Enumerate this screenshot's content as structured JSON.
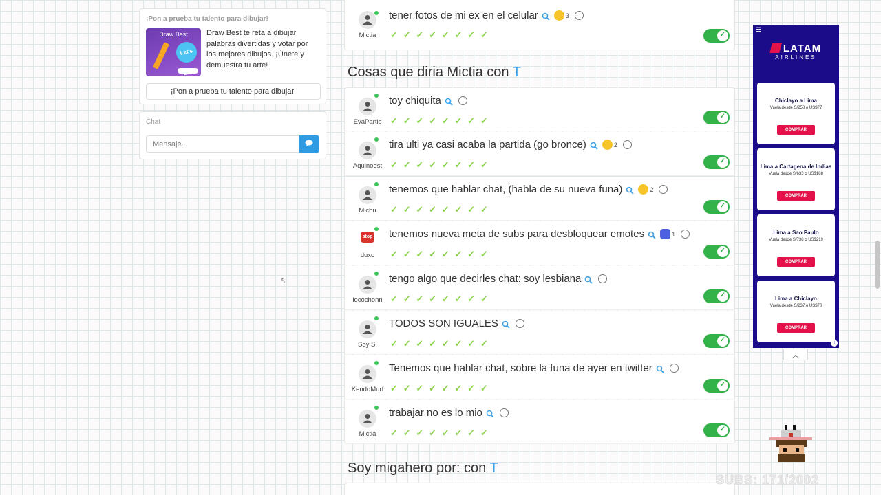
{
  "promo": {
    "title": "¡Pon a prueba tu talento para dibujar!",
    "image_title": "Draw Best",
    "image_badge": "Let's draw!",
    "text": "Draw Best te reta a dibujar palabras divertidas y votar por los mejores dibujos. ¡Únete y demuestra tu arte!",
    "button": "¡Pon a prueba tu talento para dibujar!"
  },
  "chat": {
    "title": "Chat",
    "placeholder": "Mensaje...",
    "send_icon": "chat-bubble-icon"
  },
  "top_row": {
    "user": "Mictia",
    "phrase": "tener fotos de mi ex en el celular",
    "reaction_count": "3"
  },
  "section1": {
    "title_prefix": "Cosas que diria Mictia con",
    "title_letter": "T"
  },
  "rows": [
    {
      "user": "EvaPartis",
      "phrase": "toy chiquita",
      "reaction": ""
    },
    {
      "user": "Aquinoest",
      "phrase": "tira ulti ya casi acaba la partida (go bronce)",
      "reaction": "2"
    },
    {
      "user": "Michu",
      "phrase": "tenemos que hablar chat, (habla de su nueva funa)",
      "reaction": "2"
    },
    {
      "user": "duxo",
      "phrase": "tenemos nueva meta de subs para desbloquear emotes",
      "reaction": "1",
      "avatar_text": "stop"
    },
    {
      "user": "locochonn",
      "phrase": "tengo algo que decirles chat: soy lesbiana",
      "reaction": ""
    },
    {
      "user": "Soy S.",
      "phrase": "TODOS SON IGUALES",
      "reaction": ""
    },
    {
      "user": "KendoMurf",
      "phrase": "Tenemos que hablar chat, sobre la funa de ayer en twitter",
      "reaction": ""
    },
    {
      "user": "Mictia",
      "phrase": "trabajar no es lo mio",
      "reaction": ""
    }
  ],
  "section2": {
    "title_prefix": "Soy migahero por: con",
    "title_letter": "T"
  },
  "ad": {
    "brand": "LATAM",
    "brand_sub": "AIRLINES",
    "cards": [
      {
        "dest": "Chiclayo a Lima",
        "price": "Vuela desde S/258 o US$77",
        "button": "COMPRAR"
      },
      {
        "dest": "Lima a Cartagena de Indias",
        "price": "Vuela desde S/633 o US$188",
        "button": "COMPRAR"
      },
      {
        "dest": "Lima a Sao Paulo",
        "price": "Vuela desde S/738 o US$219",
        "button": "COMPRAR"
      },
      {
        "dest": "Lima a Chiclayo",
        "price": "Vuela desde S/237 o US$70",
        "button": "COMPRAR"
      }
    ]
  },
  "overlay": {
    "subs_text": "SUBS: 171/2002"
  }
}
